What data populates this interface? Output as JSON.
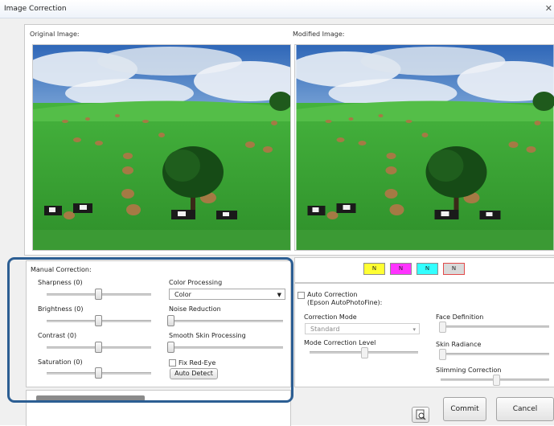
{
  "window": {
    "title": "Image Correction"
  },
  "original": {
    "label": "Original Image:"
  },
  "modified": {
    "label": "Modified Image:"
  },
  "manual": {
    "header": "Manual Correction:",
    "sharpness": {
      "label": "Sharpness (0)",
      "value": 0
    },
    "brightness": {
      "label": "Brightness (0)",
      "value": 0
    },
    "contrast": {
      "label": "Contrast (0)",
      "value": 0
    },
    "saturation": {
      "label": "Saturation (0)",
      "value": 0
    },
    "color_processing": {
      "label": "Color Processing",
      "selected": "Color"
    },
    "noise_reduction": {
      "label": "Noise Reduction"
    },
    "smooth_skin": {
      "label": "Smooth Skin Processing"
    },
    "fix_red_eye": {
      "label": "Fix Red-Eye",
      "checked": false
    },
    "auto_detect": "Auto Detect"
  },
  "swatches": [
    {
      "label": "N",
      "color": "#ffff33"
    },
    {
      "label": "N",
      "color": "#ff33ff"
    },
    {
      "label": "N",
      "color": "#33ffff"
    },
    {
      "label": "N",
      "color": "#d9d9d9"
    }
  ],
  "auto": {
    "checkbox_label": "Auto Correction",
    "sub_label": "(Epson AutoPhotoFine):",
    "checked": false,
    "mode_label": "Correction Mode",
    "mode_value": "Standard",
    "level_label": "Mode Correction Level",
    "face_definition": "Face Definition",
    "skin_radiance": "Skin Radiance",
    "slimming": "Slimming Correction"
  },
  "footer": {
    "commit": "Commit",
    "cancel": "Cancel"
  },
  "colors": {
    "highlight": "#2c5e93",
    "sky": "#3a73c5",
    "grass": "#3fa83a"
  },
  "icons": [
    "close-icon",
    "dropdown-arrow-icon",
    "print-preview-icon"
  ]
}
